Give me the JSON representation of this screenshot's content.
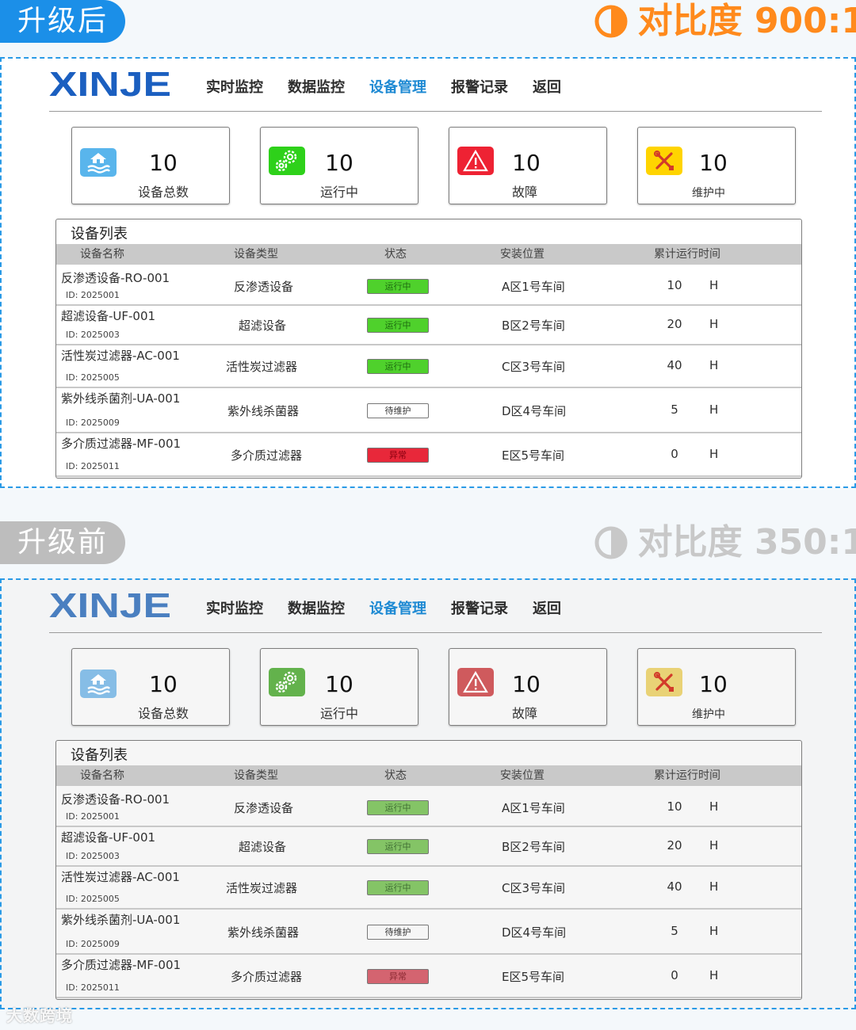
{
  "after": {
    "tag": "升级后",
    "contrast": "对比度 900:1",
    "accent": "#ff8a1c",
    "tag_color": "#1b8fe8"
  },
  "before": {
    "tag": "升级前",
    "contrast": "对比度 350:1",
    "accent": "#c8c8c8",
    "tag_color": "#bdbdbd"
  },
  "logo": "XINJE",
  "nav": [
    "实时监控",
    "数据监控",
    "设备管理",
    "报警记录",
    "返回"
  ],
  "nav_active_index": 2,
  "cards": [
    {
      "value": "10",
      "label": "设备总数",
      "icon": "house-water-icon"
    },
    {
      "value": "10",
      "label": "运行中",
      "icon": "gears-icon"
    },
    {
      "value": "10",
      "label": "故障",
      "icon": "warning-triangle-icon"
    },
    {
      "value": "10",
      "label": "维护中",
      "icon": "wrench-screwdriver-icon"
    }
  ],
  "list": {
    "title": "设备列表",
    "columns": [
      "设备名称",
      "设备类型",
      "状态",
      "安装位置",
      "累计运行时间"
    ],
    "rows": [
      {
        "name": "反渗透设备-RO-001",
        "id": "ID: 2025001",
        "type": "反渗透设备",
        "status": "运行中",
        "status_kind": "running",
        "location": "A区1号车间",
        "hours": "10",
        "unit": "H"
      },
      {
        "name": "超滤设备-UF-001",
        "id": "ID: 2025003",
        "type": "超滤设备",
        "status": "运行中",
        "status_kind": "running",
        "location": "B区2号车间",
        "hours": "20",
        "unit": "H"
      },
      {
        "name": "活性炭过滤器-AC-001",
        "id": "ID: 2025005",
        "type": "活性炭过滤器",
        "status": "运行中",
        "status_kind": "running",
        "location": "C区3号车间",
        "hours": "40",
        "unit": "H"
      },
      {
        "name": "紫外线杀菌剂-UA-001",
        "id": "ID: 2025009",
        "type": "紫外线杀菌器",
        "status": "待维护",
        "status_kind": "maintenance",
        "location": "D区4号车间",
        "hours": "5",
        "unit": "H"
      },
      {
        "name": "多介质过滤器-MF-001",
        "id": "ID: 2025011",
        "type": "多介质过滤器",
        "status": "异常",
        "status_kind": "fault",
        "location": "E区5号车间",
        "hours": "0",
        "unit": "H"
      }
    ]
  },
  "colors_after": {
    "logo": "#1b5fc0",
    "icon_total": "#59b5ec",
    "icon_running": "#2ed11a",
    "icon_fault": "#ee2233",
    "icon_maint": "#ffd400",
    "badge_running": "#4fd12c",
    "badge_running_text": "#1d6a10",
    "badge_maint": "#ffd21e",
    "badge_maint_text": "#d07a00",
    "badge_fault": "#e8283a",
    "badge_fault_text": "#8a0010"
  },
  "colors_before": {
    "logo": "#4a7fc0",
    "icon_total": "#86bde6",
    "icon_running": "#63b24c",
    "icon_fault": "#cf5a5d",
    "icon_maint": "#e9d276",
    "badge_running": "#84c466",
    "badge_running_text": "#3f6d33",
    "badge_maint": "#ecd07e",
    "badge_maint_text": "#c08a3b",
    "badge_fault": "#d46470",
    "badge_fault_text": "#8c2a33"
  },
  "watermark": "大数跨境"
}
